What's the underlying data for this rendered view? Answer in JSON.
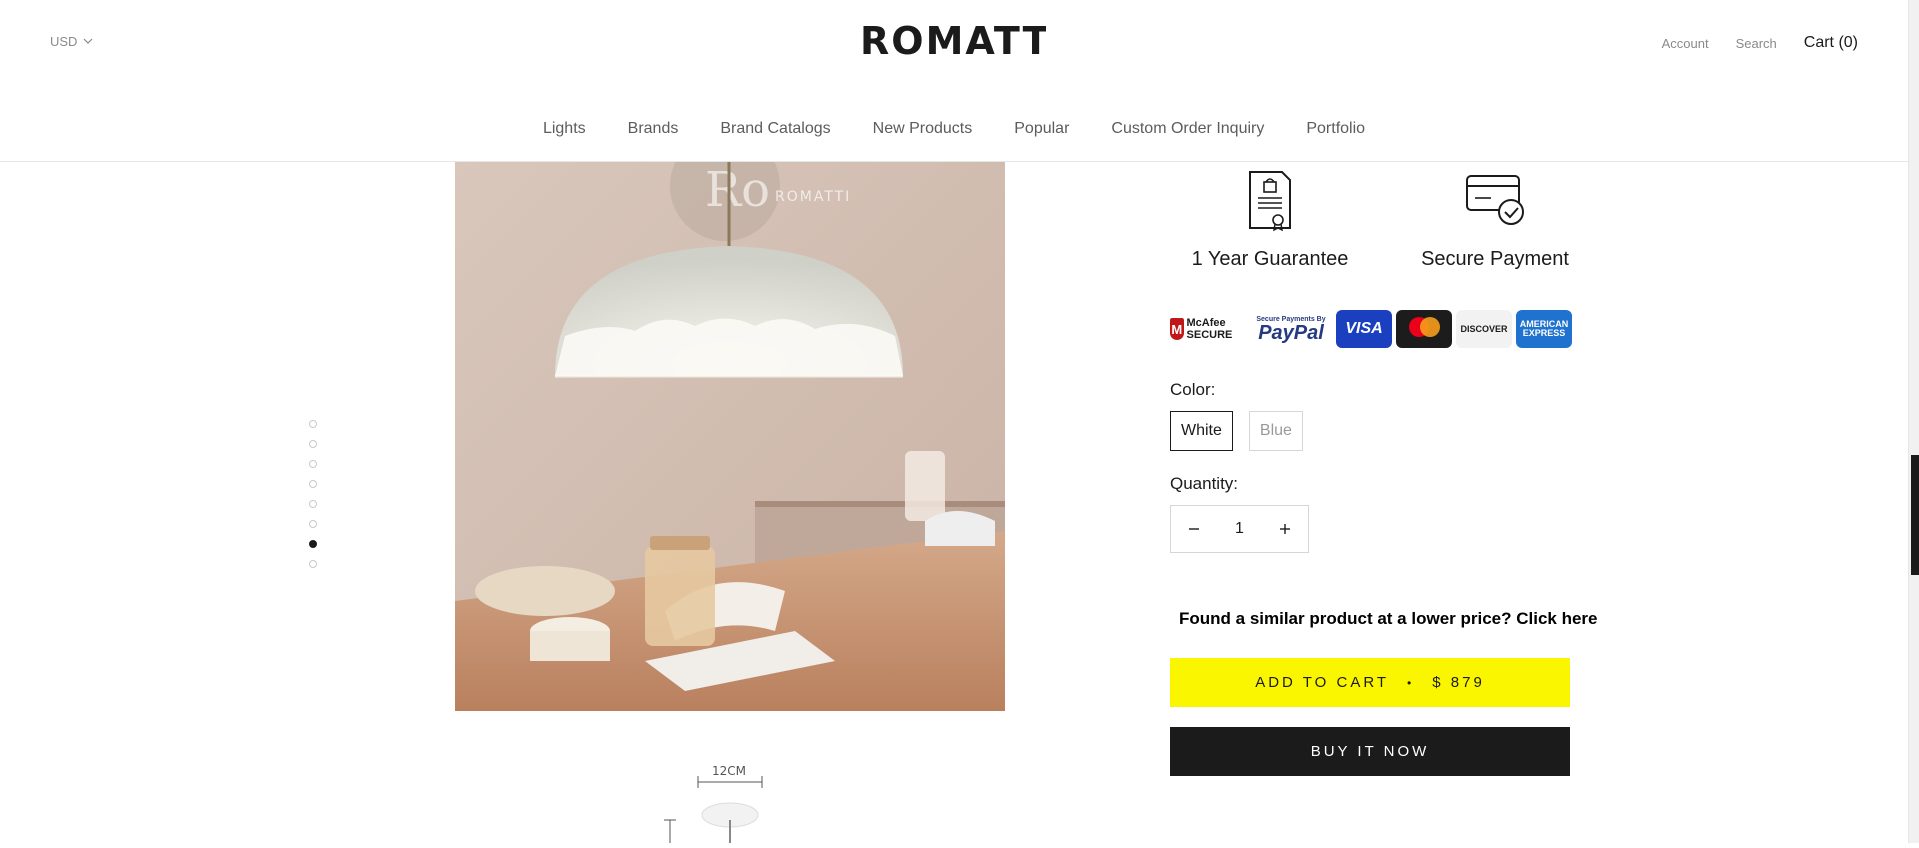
{
  "header": {
    "currency": "USD",
    "logo": "ROMATTI",
    "account": "Account",
    "search": "Search",
    "cart": "Cart (0)"
  },
  "nav": {
    "items": [
      "Lights",
      "Brands",
      "Brand Catalogs",
      "New Products",
      "Popular",
      "Custom Order Inquiry",
      "Portfolio"
    ]
  },
  "gallery": {
    "dot_count": 8,
    "active_index": 6,
    "watermark": "ROMATTI",
    "dimension_label": "12CM"
  },
  "badges": {
    "guarantee": "1 Year Guarantee",
    "payment": "Secure Payment"
  },
  "payment_logos": {
    "mcafee": "McAfee SECURE",
    "paypal_small": "Secure Payments By",
    "paypal": "PayPal",
    "visa": "VISA",
    "mastercard": "mastercard",
    "discover": "DISCOVER",
    "amex": "AMERICAN EXPRESS"
  },
  "options": {
    "color_label": "Color:",
    "colors": [
      "White",
      "Blue"
    ],
    "selected_color": "White",
    "quantity_label": "Quantity:",
    "quantity": "1"
  },
  "lower_price_text": "Found a similar product at a lower price? Click here",
  "add_to_cart": {
    "label": "ADD TO CART",
    "separator": "•",
    "price": "$ 879"
  },
  "buy_now": "BUY IT NOW",
  "colors": {
    "accent_yellow": "#faf600",
    "dark": "#1c1b1b"
  }
}
